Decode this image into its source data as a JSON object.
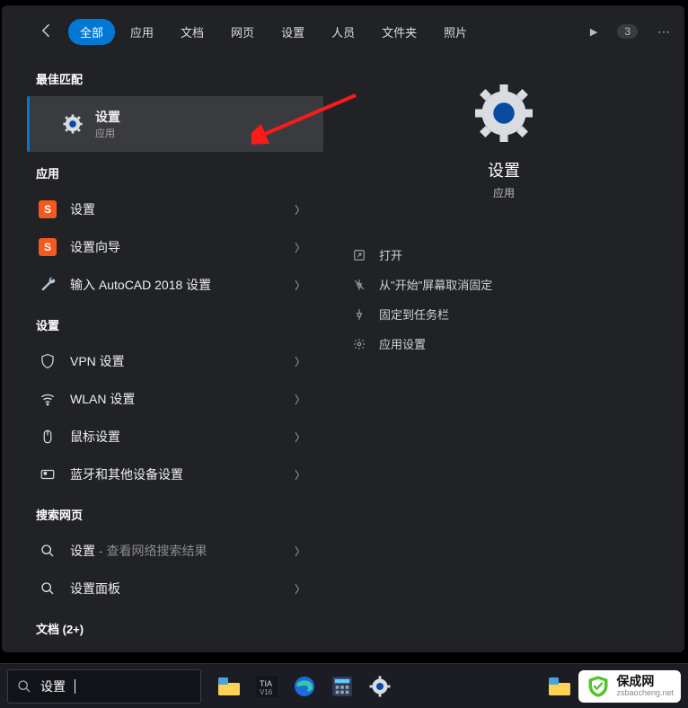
{
  "header": {
    "tabs": [
      "全部",
      "应用",
      "文档",
      "网页",
      "设置",
      "人员",
      "文件夹",
      "照片"
    ],
    "active_tab_index": 0,
    "badge": "3"
  },
  "left": {
    "sections": {
      "best": {
        "title": "最佳匹配"
      },
      "apps": {
        "title": "应用"
      },
      "settings": {
        "title": "设置"
      },
      "web": {
        "title": "搜索网页"
      },
      "docs": {
        "title": "文档 (2+)"
      }
    },
    "best_match": {
      "title": "设置",
      "subtitle": "应用"
    },
    "apps": [
      {
        "icon": "s-orange-icon",
        "label": "设置"
      },
      {
        "icon": "s-orange-icon",
        "label": "设置向导"
      },
      {
        "icon": "wrench-icon",
        "label": "输入 AutoCAD 2018 设置"
      }
    ],
    "settings_items": [
      {
        "icon": "shield-outline-icon",
        "label": "VPN 设置"
      },
      {
        "icon": "wifi-icon",
        "label": "WLAN 设置"
      },
      {
        "icon": "mouse-icon",
        "label": "鼠标设置"
      },
      {
        "icon": "bluetooth-icon",
        "label": "蓝牙和其他设备设置"
      }
    ],
    "web_items": [
      {
        "icon": "search-icon",
        "label": "设置",
        "suffix": " - 查看网络搜索结果"
      },
      {
        "icon": "search-icon",
        "label": "设置面板"
      }
    ]
  },
  "right": {
    "title": "设置",
    "subtitle": "应用",
    "actions": [
      {
        "icon": "open-icon",
        "label": "打开"
      },
      {
        "icon": "unpin-icon",
        "label": "从\"开始\"屏幕取消固定"
      },
      {
        "icon": "pin-taskbar-icon",
        "label": "固定到任务栏"
      },
      {
        "icon": "gear-small-icon",
        "label": "应用设置"
      }
    ]
  },
  "taskbar": {
    "search_value": "设置",
    "icons": [
      "explorer-icon",
      "tia-icon",
      "edge-icon",
      "calculator-icon",
      "settings-icon",
      "explorer2-icon"
    ]
  },
  "watermark": {
    "zh": "保成网",
    "en": "zsbaocheng.net"
  }
}
